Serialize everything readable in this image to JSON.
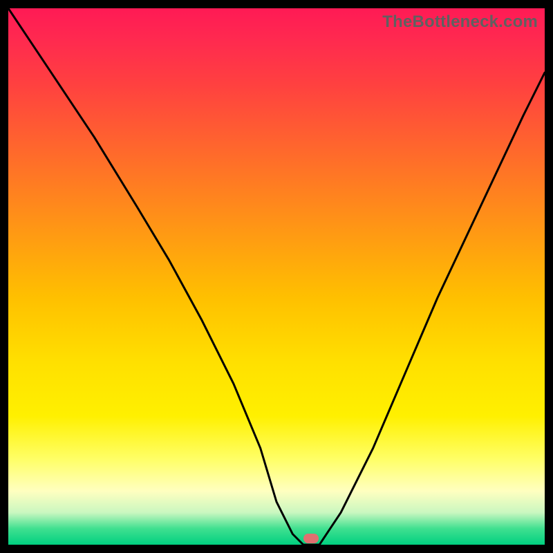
{
  "watermark": "TheBottleneck.com",
  "chart_data": {
    "type": "line",
    "title": "",
    "xlabel": "",
    "ylabel": "",
    "x_range": [
      0,
      100
    ],
    "y_range": [
      0,
      100
    ],
    "series": [
      {
        "name": "curve",
        "x": [
          0,
          8,
          16,
          24,
          30,
          36,
          42,
          47,
          50,
          53,
          55,
          58,
          62,
          68,
          74,
          80,
          88,
          96,
          100
        ],
        "values": [
          100,
          88,
          76,
          63,
          53,
          42,
          30,
          18,
          8,
          2,
          0,
          0,
          6,
          18,
          32,
          46,
          63,
          80,
          88
        ]
      }
    ],
    "marker": {
      "x": 56.5,
      "y": 1.2,
      "color": "#e07070"
    },
    "gradient_bands": [
      "#ff1a55",
      "#ff4040",
      "#ff8020",
      "#ffc000",
      "#ffff66",
      "#ffffc0",
      "#40e090",
      "#00d080"
    ]
  }
}
